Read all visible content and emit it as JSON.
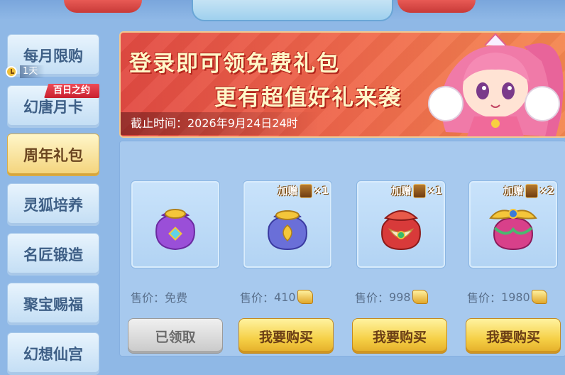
{
  "sidebar": {
    "items": [
      {
        "label": "每月限购"
      },
      {
        "label": "幻唐月卡"
      },
      {
        "label": "周年礼包"
      },
      {
        "label": "灵狐培养"
      },
      {
        "label": "名匠锻造"
      },
      {
        "label": "聚宝赐福"
      },
      {
        "label": "幻想仙宫"
      }
    ],
    "timer_text": "1天",
    "ribbon_text": "百日之约",
    "active_index": 2
  },
  "banner": {
    "line1": "登录即可领免费礼包",
    "line2": "更有超值好礼来袭",
    "deadline": "截止时间：2026年9月24日24时"
  },
  "gifts": [
    {
      "icon": "gift-bag-purple-icon",
      "bonus_label": "",
      "bonus_count": "",
      "price_label": "售价：",
      "price": "免费",
      "show_coin": false,
      "button": "已领取",
      "claimed": true
    },
    {
      "icon": "gift-bag-blue-icon",
      "bonus_label": "加赠",
      "bonus_count": "×1",
      "price_label": "售价：",
      "price": "410",
      "show_coin": true,
      "button": "我要购买",
      "claimed": false
    },
    {
      "icon": "gift-bag-red-icon",
      "bonus_label": "加赠",
      "bonus_count": "×1",
      "price_label": "售价：",
      "price": "998",
      "show_coin": true,
      "button": "我要购买",
      "claimed": false
    },
    {
      "icon": "gift-bag-ornate-icon",
      "bonus_label": "加赠",
      "bonus_count": "×2",
      "price_label": "售价：",
      "price": "1980",
      "show_coin": true,
      "button": "我要购买",
      "claimed": false
    }
  ],
  "colors": {
    "panel_bg": "#a7c9ee",
    "buy_button": "#f5cf45",
    "claimed_button": "#c9c9c9",
    "banner_bg": "#e24a42"
  }
}
